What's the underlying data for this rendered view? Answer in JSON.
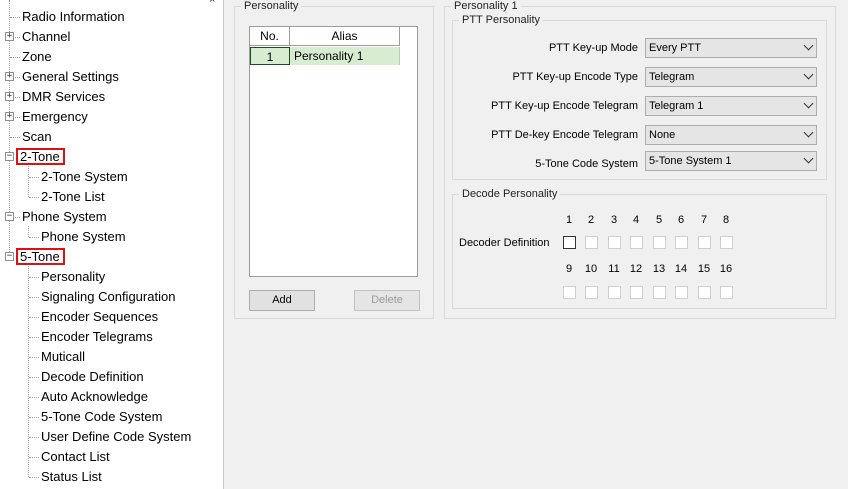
{
  "tree": {
    "close_glyph": "×",
    "items": [
      {
        "label": "Radio Information",
        "expander": ""
      },
      {
        "label": "Channel",
        "expander": "+"
      },
      {
        "label": "Zone",
        "expander": ""
      },
      {
        "label": "General Settings",
        "expander": "+"
      },
      {
        "label": "DMR Services",
        "expander": "+"
      },
      {
        "label": "Emergency",
        "expander": "+"
      },
      {
        "label": "Scan",
        "expander": ""
      },
      {
        "label": "2-Tone",
        "expander": "−"
      },
      {
        "label": "2-Tone System",
        "expander": ""
      },
      {
        "label": "2-Tone List",
        "expander": ""
      },
      {
        "label": "Phone System",
        "expander": "−"
      },
      {
        "label": "Phone System",
        "expander": ""
      },
      {
        "label": "5-Tone",
        "expander": "−"
      },
      {
        "label": "Personality",
        "expander": ""
      },
      {
        "label": "Signaling Configuration",
        "expander": ""
      },
      {
        "label": "Encoder Sequences",
        "expander": ""
      },
      {
        "label": "Encoder Telegrams",
        "expander": ""
      },
      {
        "label": "Muticall",
        "expander": ""
      },
      {
        "label": "Decode Definition",
        "expander": ""
      },
      {
        "label": "Auto Acknowledge",
        "expander": ""
      },
      {
        "label": "5-Tone Code System",
        "expander": ""
      },
      {
        "label": "User Define Code System",
        "expander": ""
      },
      {
        "label": "Contact List",
        "expander": ""
      },
      {
        "label": "Status List",
        "expander": ""
      }
    ]
  },
  "personality_list": {
    "legend": "Personality",
    "columns": [
      "No.",
      "Alias"
    ],
    "rows": [
      {
        "no": "1",
        "alias": "Personality 1"
      }
    ],
    "add_label": "Add",
    "delete_label": "Delete"
  },
  "detail": {
    "legend": "Personality 1",
    "ptt": {
      "legend": "PTT Personality",
      "fields": [
        {
          "label": "PTT Key-up Mode",
          "value": "Every PTT"
        },
        {
          "label": "PTT Key-up Encode Type",
          "value": "Telegram"
        },
        {
          "label": "PTT Key-up Encode Telegram",
          "value": "Telegram 1"
        },
        {
          "label": "PTT De-key Encode Telegram",
          "value": "None"
        },
        {
          "label": "5-Tone Code System",
          "value": "5-Tone System 1"
        }
      ]
    },
    "decode": {
      "legend": "Decode Personality",
      "label": "Decoder Definition",
      "numbers_row1": [
        "1",
        "2",
        "3",
        "4",
        "5",
        "6",
        "7",
        "8"
      ],
      "numbers_row2": [
        "9",
        "10",
        "11",
        "12",
        "13",
        "14",
        "15",
        "16"
      ],
      "checked": []
    }
  },
  "colors": {
    "highlight_box": "#e01010",
    "selected_row": "#d7ecd0"
  }
}
